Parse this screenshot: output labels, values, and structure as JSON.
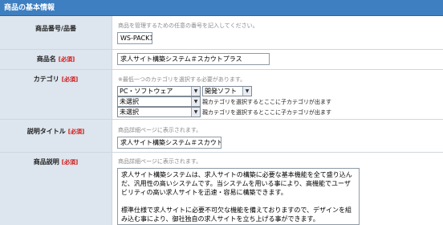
{
  "section": {
    "title": "商品の基本情報"
  },
  "fields": {
    "product_code": {
      "label": "商品番号/品番",
      "note": "商品を管理するための任意の番号を記入してください。",
      "value": "WS-PACK1"
    },
    "product_name": {
      "label": "商品名",
      "required": "[必須]",
      "value": "求人サイト構築システム＃スカウトプラス"
    },
    "category": {
      "label": "カテゴリ",
      "required": "[必須]",
      "note": "※最低一つのカテゴリを選択する必要があります。",
      "selects": [
        {
          "value": "PC・ソフトウェア",
          "sub_value": "開発ソフト"
        },
        {
          "value": "未選択",
          "hint": "親カテゴリを選択するとここに子カテゴリが出ます"
        },
        {
          "value": "未選択",
          "hint": "親カテゴリを選択するとここに子カテゴリが出ます"
        }
      ]
    },
    "description_title": {
      "label": "説明タイトル",
      "required": "[必須]",
      "note": "商品詳細ページに表示されます。",
      "value": "求人サイト構築システム＃スカウトプラス"
    },
    "description": {
      "label": "商品説明",
      "required": "[必須]",
      "note": "商品詳細ページに表示されます。",
      "paragraph1": "求人サイト構築システムは、求人サイトの構築に必要な基本機能を全て盛り込んだ、汎用性の高いシステムです。当システムを用いる事により、高機能でユーザビリティの高い求人サイトを迅速・容易に構築できます。",
      "paragraph2": "標準仕様で求人サイトに必要不可欠な機能を備えておりますので、デザインを組み込む事により、御社独自の求人サイトを立ち上げる事ができます。"
    }
  },
  "icons": {
    "dropdown": "chevron-down-icon"
  },
  "colors": {
    "header_bg": "#3d7fc1",
    "label_bg": "#dde5ee",
    "required": "#d01010"
  }
}
